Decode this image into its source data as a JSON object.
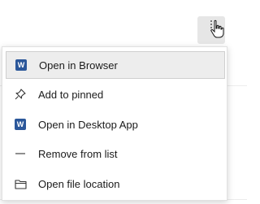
{
  "menu": {
    "items": [
      {
        "label": "Open in Browser",
        "icon": "word-icon",
        "highlighted": true
      },
      {
        "label": "Add to pinned",
        "icon": "pin-icon",
        "highlighted": false
      },
      {
        "label": "Open in Desktop App",
        "icon": "word-icon",
        "highlighted": false
      },
      {
        "label": "Remove from list",
        "icon": "dash-icon",
        "highlighted": false
      },
      {
        "label": "Open file location",
        "icon": "folder-icon",
        "highlighted": false
      }
    ]
  },
  "word_icon_letter": "W",
  "colors": {
    "word_blue": "#2b579a",
    "highlight_bg": "#ededed"
  }
}
